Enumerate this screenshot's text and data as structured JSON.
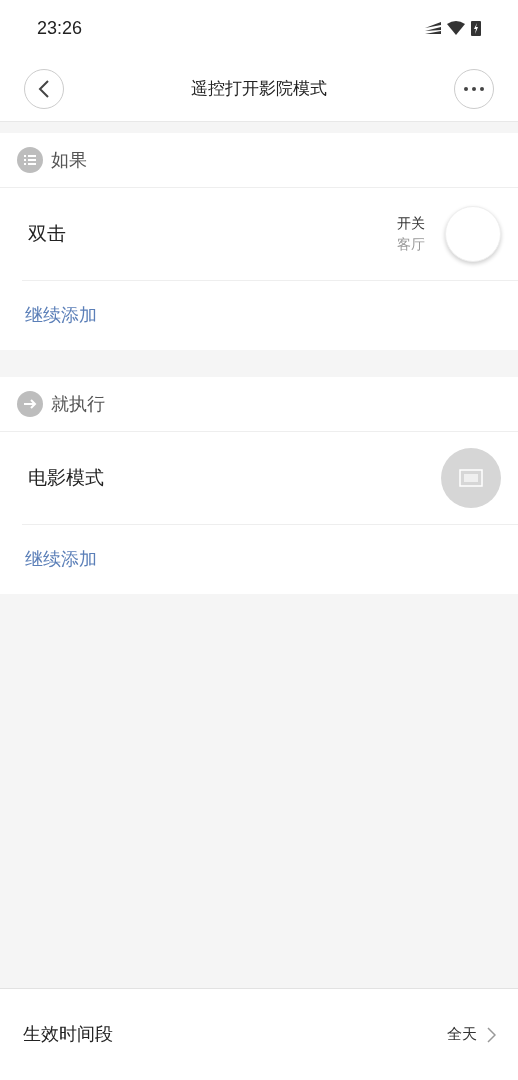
{
  "status_bar": {
    "time": "23:26"
  },
  "header": {
    "title": "遥控打开影院模式"
  },
  "sections": [
    {
      "kind": "condition",
      "heading": "如果",
      "items": [
        {
          "kind": "device",
          "name": "双击",
          "detail": "开关",
          "room": "客厅"
        }
      ],
      "add_link": "继续添加"
    },
    {
      "kind": "action",
      "heading": "就执行",
      "items": [
        {
          "kind": "scene",
          "name": "电影模式"
        }
      ],
      "add_link": "继续添加"
    }
  ],
  "footer": {
    "label": "生效时间段",
    "value": "全天"
  }
}
